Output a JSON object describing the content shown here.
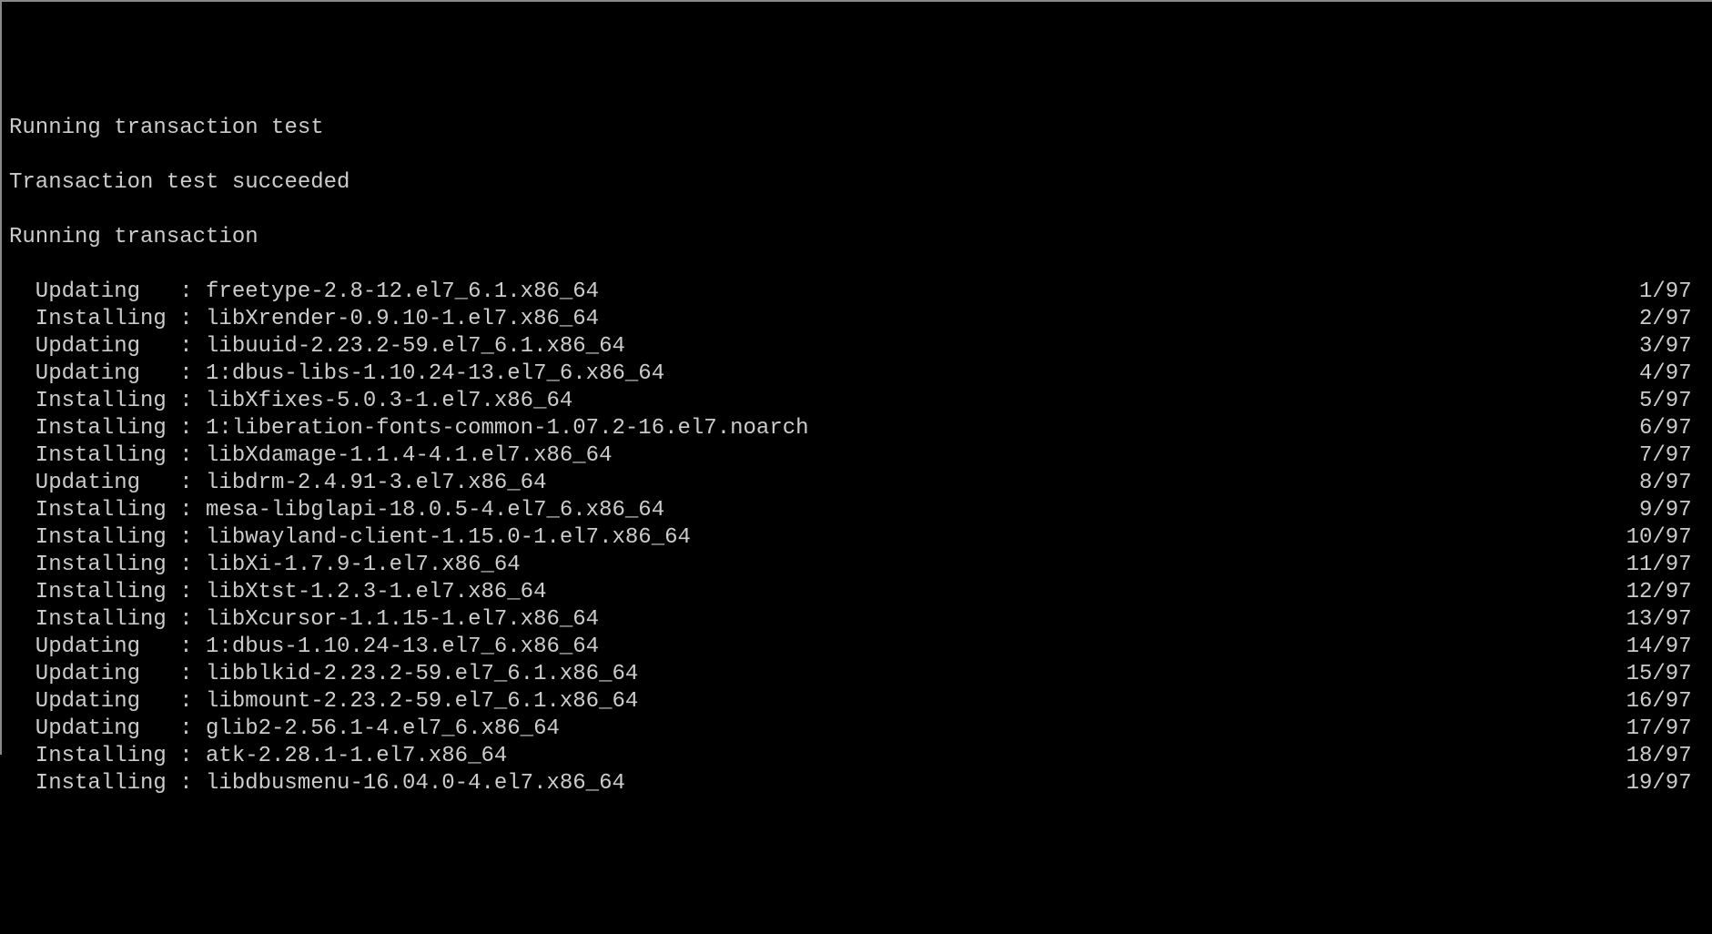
{
  "header": {
    "line1": "Running transaction test",
    "line2": "Transaction test succeeded",
    "line3": "Running transaction"
  },
  "total": "97",
  "packages": [
    {
      "action": "Updating",
      "name": "freetype-2.8-12.el7_6.1.x86_64",
      "index": "1"
    },
    {
      "action": "Installing",
      "name": "libXrender-0.9.10-1.el7.x86_64",
      "index": "2"
    },
    {
      "action": "Updating",
      "name": "libuuid-2.23.2-59.el7_6.1.x86_64",
      "index": "3"
    },
    {
      "action": "Updating",
      "name": "1:dbus-libs-1.10.24-13.el7_6.x86_64",
      "index": "4"
    },
    {
      "action": "Installing",
      "name": "libXfixes-5.0.3-1.el7.x86_64",
      "index": "5"
    },
    {
      "action": "Installing",
      "name": "1:liberation-fonts-common-1.07.2-16.el7.noarch",
      "index": "6"
    },
    {
      "action": "Installing",
      "name": "libXdamage-1.1.4-4.1.el7.x86_64",
      "index": "7"
    },
    {
      "action": "Updating",
      "name": "libdrm-2.4.91-3.el7.x86_64",
      "index": "8"
    },
    {
      "action": "Installing",
      "name": "mesa-libglapi-18.0.5-4.el7_6.x86_64",
      "index": "9"
    },
    {
      "action": "Installing",
      "name": "libwayland-client-1.15.0-1.el7.x86_64",
      "index": "10"
    },
    {
      "action": "Installing",
      "name": "libXi-1.7.9-1.el7.x86_64",
      "index": "11"
    },
    {
      "action": "Installing",
      "name": "libXtst-1.2.3-1.el7.x86_64",
      "index": "12"
    },
    {
      "action": "Installing",
      "name": "libXcursor-1.1.15-1.el7.x86_64",
      "index": "13"
    },
    {
      "action": "Updating",
      "name": "1:dbus-1.10.24-13.el7_6.x86_64",
      "index": "14"
    },
    {
      "action": "Updating",
      "name": "libblkid-2.23.2-59.el7_6.1.x86_64",
      "index": "15"
    },
    {
      "action": "Updating",
      "name": "libmount-2.23.2-59.el7_6.1.x86_64",
      "index": "16"
    },
    {
      "action": "Updating",
      "name": "glib2-2.56.1-4.el7_6.x86_64",
      "index": "17"
    },
    {
      "action": "Installing",
      "name": "atk-2.28.1-1.el7.x86_64",
      "index": "18"
    },
    {
      "action": "Installing",
      "name": "libdbusmenu-16.04.0-4.el7.x86_64",
      "index": "19"
    }
  ]
}
